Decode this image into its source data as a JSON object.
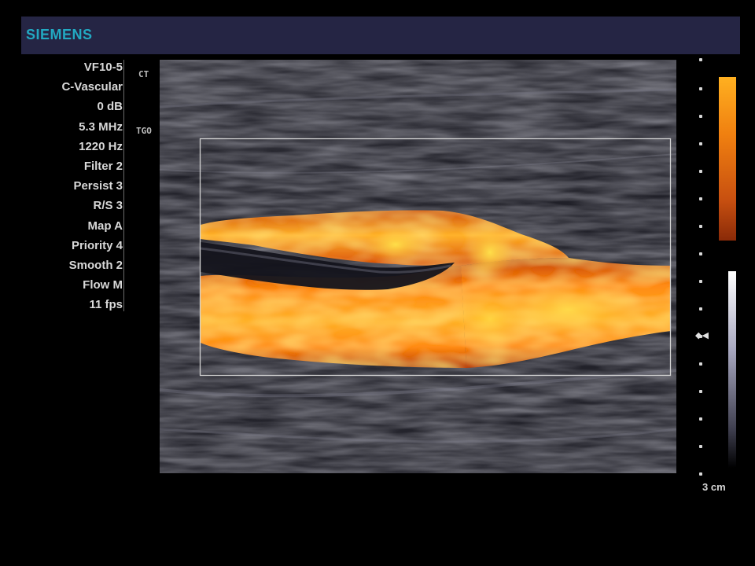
{
  "header": {
    "brand": "SIEMENS"
  },
  "parameters": [
    "VF10-5",
    "C-Vascular",
    "0 dB",
    "5.3 MHz",
    "1220 Hz",
    "Filter 2",
    "Persist 3",
    "R/S 3",
    "Map A",
    "Priority 4",
    "Smooth 2",
    "Flow M",
    "11 fps"
  ],
  "indicators": {
    "ct": "CT",
    "tgo": "TGO"
  },
  "depth": {
    "label": "3 cm"
  },
  "colors": {
    "brand": "#22a9c2",
    "header_bg": "#252544",
    "flow_bright": "#ffd23a",
    "flow_mid": "#ff8a12",
    "flow_dark": "#a8300a"
  },
  "icons": {
    "focus": "focus-marker-icon",
    "ct": "ct-icon"
  }
}
